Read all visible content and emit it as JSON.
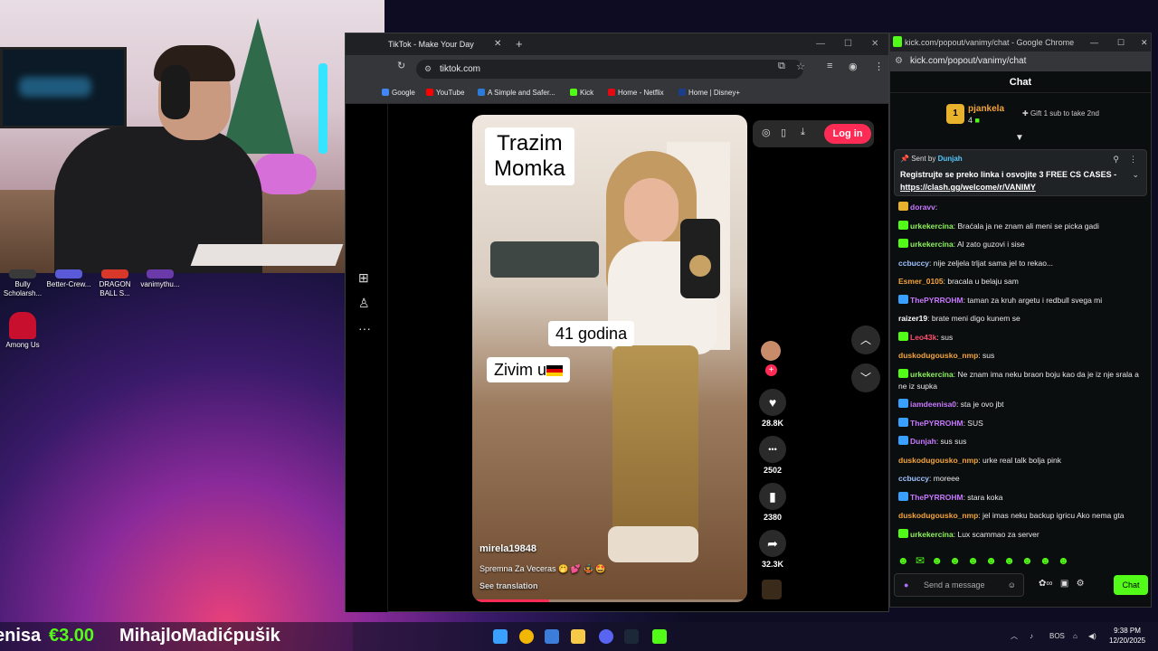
{
  "desktop_icons": [
    {
      "label": "Bully Scholarsh..."
    },
    {
      "label": "Better-Crew..."
    },
    {
      "label": "DRAGON BALL S..."
    },
    {
      "label": "vanimythu..."
    },
    {
      "label": "Among Us"
    }
  ],
  "tiktok_window": {
    "tab_title": "TikTok - Make Your Day",
    "url": "tiktok.com",
    "bookmarks": [
      "Google",
      "YouTube",
      "A Simple and Safer...",
      "Kick",
      "Home - Netflix",
      "Home | Disney+"
    ],
    "login_label": "Log in",
    "video": {
      "caption_title": "Trazim\nMomka",
      "caption_age": "41 godina",
      "caption_live": "Zivim u",
      "username": "mirela19848",
      "description": "Spremna Za Veceras 🤭 💕 🤹 🤩",
      "see_translation": "See translation",
      "progress": 0.28
    },
    "actions": [
      {
        "icon": "heart-icon",
        "glyph": "♥",
        "count": "28.8K"
      },
      {
        "icon": "comment-icon",
        "glyph": "•••",
        "count": "2502"
      },
      {
        "icon": "bookmark-icon",
        "glyph": "▮",
        "count": "2380"
      },
      {
        "icon": "share-icon",
        "glyph": "➦",
        "count": "32.3K"
      }
    ]
  },
  "chat_window": {
    "title": "kick.com/popout/vanimy/chat - Google Chrome",
    "url": "kick.com/popout/vanimy/chat",
    "header": "Chat",
    "top_gifter": {
      "rank": "1",
      "name": "pjankela",
      "count": "4",
      "gift_label": "Gift 1 sub to take 2nd"
    },
    "pinned": {
      "sent_by_label": "Sent by",
      "sender": "Dunjah",
      "text": "Registrujte se preko linka i osvojite 3 FREE CS CASES",
      "link_prefix": " - ",
      "link": "https://clash.gg/welcome/r/VANIMY"
    },
    "messages": [
      {
        "user": "doravv",
        "color": "#c778ff",
        "text": "",
        "badge": "#e8b22d"
      },
      {
        "user": "urkekercina",
        "color": "#8ef35b",
        "text": "Braćala ja ne znam ali meni se picka gadi",
        "badge": "#53fc18"
      },
      {
        "user": "urkekercina",
        "color": "#8ef35b",
        "text": "Al zato guzovi i sise",
        "badge": "#53fc18"
      },
      {
        "user": "ccbuccy",
        "color": "#9fc3ff",
        "text": "nije zeljela trljat sama jel to rekao...",
        "badge": ""
      },
      {
        "user": "Esmer_0105",
        "color": "#f3a43b",
        "text": "bracala u belaju sam",
        "badge": ""
      },
      {
        "user": "ThePYRROHM",
        "color": "#c778ff",
        "text": "taman za kruh argetu i redbull svega mi",
        "badge": "#3aa0ff"
      },
      {
        "user": "raizer19",
        "color": "#ffffff",
        "text": "brate meni digo kunem se",
        "badge": ""
      },
      {
        "user": "Leo43k",
        "color": "#ff4d6d",
        "text": "sus",
        "badge": "#53fc18"
      },
      {
        "user": "duskodugousko_nmp",
        "color": "#f3a43b",
        "text": "sus",
        "badge": ""
      },
      {
        "user": "urkekercina",
        "color": "#8ef35b",
        "text": "Ne znam ima neku braon boju kao da je iz nje srala a ne iz supka",
        "badge": "#53fc18"
      },
      {
        "user": "iamdeenisa0",
        "color": "#c778ff",
        "text": "sta je ovo jbt",
        "badge": "#3aa0ff"
      },
      {
        "user": "ThePYRROHM",
        "color": "#c778ff",
        "text": "SUS",
        "badge": "#3aa0ff"
      },
      {
        "user": "Dunjah",
        "color": "#c778ff",
        "text": "sus sus",
        "badge": "#3aa0ff"
      },
      {
        "user": "duskodugousko_nmp",
        "color": "#f3a43b",
        "text": "urke real talk bolja pink",
        "badge": ""
      },
      {
        "user": "ccbuccy",
        "color": "#9fc3ff",
        "text": "moreee",
        "badge": ""
      },
      {
        "user": "ThePYRROHM",
        "color": "#c778ff",
        "text": "stara koka",
        "badge": "#3aa0ff"
      },
      {
        "user": "duskodugousko_nmp",
        "color": "#f3a43b",
        "text": "jel imas neku backup igricu Ako nema gta",
        "badge": ""
      },
      {
        "user": "urkekercina",
        "color": "#8ef35b",
        "text": "Lux scammao za server",
        "badge": "#53fc18"
      }
    ],
    "input_placeholder": "Send a message",
    "chat_button": "Chat"
  },
  "ticker": {
    "name_left": "enisa",
    "amount": "€3.00",
    "name_right": "MihajloMadićpušik"
  },
  "taskbar": {
    "lang": "BOS",
    "time": "9:38 PM",
    "date": "12/20/2025"
  },
  "colors": {
    "kick_green": "#53fc18",
    "tiktok_red": "#fe2c55"
  }
}
